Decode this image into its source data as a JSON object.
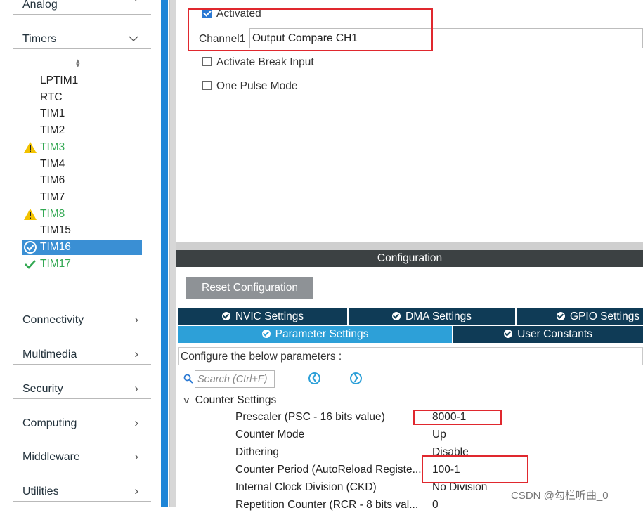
{
  "sidebar": {
    "categories_top": [
      {
        "label": "Analog"
      },
      {
        "label": "Timers"
      }
    ],
    "peripherals": [
      {
        "label": "LPTIM1",
        "status": "none"
      },
      {
        "label": "RTC",
        "status": "none"
      },
      {
        "label": "TIM1",
        "status": "none"
      },
      {
        "label": "TIM2",
        "status": "none"
      },
      {
        "label": "TIM3",
        "status": "warning"
      },
      {
        "label": "TIM4",
        "status": "none"
      },
      {
        "label": "TIM6",
        "status": "none"
      },
      {
        "label": "TIM7",
        "status": "none"
      },
      {
        "label": "TIM8",
        "status": "warning"
      },
      {
        "label": "TIM15",
        "status": "none"
      },
      {
        "label": "TIM16",
        "status": "selected-ok"
      },
      {
        "label": "TIM17",
        "status": "ok"
      }
    ],
    "categories_bottom": [
      {
        "label": "Connectivity"
      },
      {
        "label": "Multimedia"
      },
      {
        "label": "Security"
      },
      {
        "label": "Computing"
      },
      {
        "label": "Middleware"
      },
      {
        "label": "Utilities"
      }
    ]
  },
  "mode": {
    "activated_label": "Activated",
    "activated_checked": true,
    "channel_label": "Channel1",
    "channel_value": "Output Compare CH1",
    "break_label": "Activate Break Input",
    "break_checked": false,
    "one_pulse_label": "One Pulse Mode",
    "one_pulse_checked": false
  },
  "config": {
    "title": "Configuration",
    "reset_label": "Reset Configuration",
    "tabs_row1": [
      {
        "label": "NVIC Settings"
      },
      {
        "label": "DMA Settings"
      },
      {
        "label": "GPIO Settings"
      }
    ],
    "tabs_row2": [
      {
        "label": "Parameter Settings",
        "active": true
      },
      {
        "label": "User Constants",
        "active": false
      }
    ],
    "description": "Configure the below parameters :",
    "search_placeholder": "Search (Ctrl+F)",
    "group_label": "Counter Settings",
    "params": [
      {
        "name": "Prescaler (PSC - 16 bits value)",
        "value": "8000-1"
      },
      {
        "name": "Counter Mode",
        "value": "Up"
      },
      {
        "name": "Dithering",
        "value": "Disable"
      },
      {
        "name": "Counter Period (AutoReload Registe...",
        "value": "100-1"
      },
      {
        "name": "Internal Clock Division (CKD)",
        "value": "No Division"
      },
      {
        "name": "Repetition Counter (RCR - 8 bits val...",
        "value": "0"
      }
    ]
  },
  "colors": {
    "sidebar_selected": "#3a8fd4",
    "tab_dark": "#0f3b56",
    "tab_active": "#2da0d8",
    "title_bar": "#3c4143",
    "highlight_box": "#e0282e",
    "warning": "#f2c200",
    "ok_green": "#32a852"
  },
  "watermark": "CSDN @勾栏听曲_0"
}
